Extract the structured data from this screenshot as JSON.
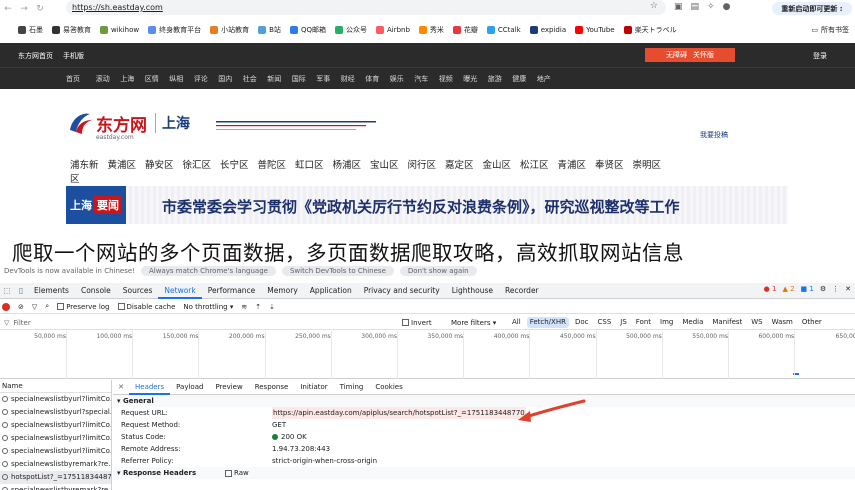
{
  "browser": {
    "url": "https://sh.eastday.com",
    "restart_label": "重新启动即可更新 :",
    "bookmarks": [
      {
        "label": "石墨",
        "color": "#444444"
      },
      {
        "label": "易答教育",
        "color": "#333333"
      },
      {
        "label": "wikihow",
        "color": "#6a9c3a"
      },
      {
        "label": "终身教育平台",
        "color": "#5b8def"
      },
      {
        "label": "小站教育",
        "color": "#e67e22"
      },
      {
        "label": "B站",
        "color": "#4ea1d3"
      },
      {
        "label": "QQ邮箱",
        "color": "#2d7be5"
      },
      {
        "label": "公众号",
        "color": "#2aae67"
      },
      {
        "label": "Airbnb",
        "color": "#ff5a5f"
      },
      {
        "label": "秀米",
        "color": "#ff8a00"
      },
      {
        "label": "花瓣",
        "color": "#e8383d"
      },
      {
        "label": "CCtalk",
        "color": "#2aa1f3"
      },
      {
        "label": "expidia",
        "color": "#1e3a7a"
      },
      {
        "label": "YouTube",
        "color": "#ff0000"
      },
      {
        "label": "楽天トラベル",
        "color": "#bf0000"
      }
    ],
    "all_bookmarks": "所有书签"
  },
  "site": {
    "top_links": [
      "东方网首页",
      "手机版"
    ],
    "promo": [
      "无障碍",
      "关怀版"
    ],
    "login": "登录",
    "nav": [
      "首页",
      "滚动",
      "上海",
      "区情",
      "纵相",
      "评论",
      "国内",
      "社会",
      "新闻",
      "国际",
      "军事",
      "财经",
      "体育",
      "娱乐",
      "汽车",
      "视频",
      "曝光",
      "旅游",
      "健康",
      "地产"
    ],
    "logo_text": "东方网",
    "logo_sub": "eastday.com",
    "logo_city": "上海",
    "tougao": "我要投稿",
    "districts": [
      "浦东新区",
      "黄浦区",
      "静安区",
      "徐汇区",
      "长宁区",
      "普陀区",
      "虹口区",
      "杨浦区",
      "宝山区",
      "闵行区",
      "嘉定区",
      "金山区",
      "松江区",
      "青浦区",
      "奉贤区",
      "崇明区"
    ],
    "banner_logo_a": "上海",
    "banner_logo_b": "要闻",
    "banner_headline": "市委常委会学习贯彻《党政机关厉行节约反对浪费条例》，研究巡视整改等工作"
  },
  "overlay_title": "爬取一个网站的多个页面数据，多页面数据爬取攻略，高效抓取网站信息",
  "devtools": {
    "message": "DevTools is now available in Chinese!",
    "message_buttons": [
      "Always match Chrome's language",
      "Switch DevTools to Chinese",
      "Don't show again"
    ],
    "tabs": [
      "Elements",
      "Console",
      "Sources",
      "Network",
      "Performance",
      "Memory",
      "Application",
      "Privacy and security",
      "Lighthouse",
      "Recorder"
    ],
    "active_tab": "Network",
    "errors": "1",
    "warnings": "2",
    "info": "1",
    "toolbar": {
      "preserve_log": "Preserve log",
      "disable_cache": "Disable cache",
      "throttling": "No throttling"
    },
    "filter": {
      "placeholder": "Filter",
      "invert": "Invert",
      "more_filters": "More filters ▾",
      "types": [
        "All",
        "Fetch/XHR",
        "Doc",
        "CSS",
        "JS",
        "Font",
        "Img",
        "Media",
        "Manifest",
        "WS",
        "Wasm",
        "Other"
      ],
      "active_type": "Fetch/XHR"
    },
    "timeline_ticks": [
      "50,000 ms",
      "100,000 ms",
      "150,000 ms",
      "200,000 ms",
      "250,000 ms",
      "300,000 ms",
      "350,000 ms",
      "400,000 ms",
      "450,000 ms",
      "500,000 ms",
      "550,000 ms",
      "600,000 ms",
      "650,000"
    ],
    "requests_header": "Name",
    "requests": [
      "specialnewslistbyurl?limitCo...",
      "specialnewslistbyurl?special...",
      "specialnewslistbyurl?limitCo...",
      "specialnewslistbyurl?limitCo...",
      "specialnewslistbyurl?limitCo...",
      "specialnewslistbyremark?re...",
      "hotspotList?_=17511834487...",
      "specialnewslistbyremark?re..."
    ],
    "selected_request": 6,
    "detail_tabs": [
      "Headers",
      "Payload",
      "Preview",
      "Response",
      "Initiator",
      "Timing",
      "Cookies"
    ],
    "active_detail_tab": "Headers",
    "general_label": "▾ General",
    "general": [
      {
        "key": "Request URL:",
        "value": "https://apin.eastday.com/apiplus/search/hotspotList?_=1751183448770"
      },
      {
        "key": "Request Method:",
        "value": "GET"
      },
      {
        "key": "Status Code:",
        "value": "200 OK"
      },
      {
        "key": "Remote Address:",
        "value": "1.94.73.208:443"
      },
      {
        "key": "Referrer Policy:",
        "value": "strict-origin-when-cross-origin"
      }
    ],
    "response_headers_label": "▾ Response Headers",
    "raw_label": "Raw"
  },
  "colors": {
    "accent": "#1a73e8",
    "arrow": "#e0412c",
    "site_dark": "#2b2b2b",
    "brand_red": "#c9161d",
    "brand_blue": "#1d3d7a"
  }
}
